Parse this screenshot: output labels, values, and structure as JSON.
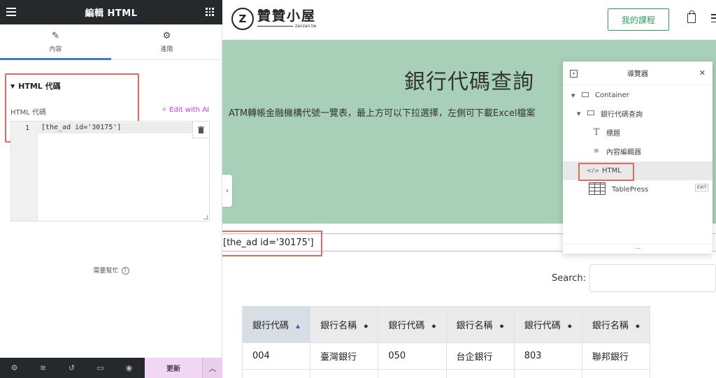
{
  "panel": {
    "title": "編輯 HTML",
    "tabs": [
      {
        "label": "內容",
        "icon": "pencil-icon",
        "active": true
      },
      {
        "label": "進階",
        "icon": "gear-icon",
        "active": false
      }
    ],
    "section_title": "HTML 代碼",
    "field_label": "HTML 代碼",
    "edit_ai_label": "✧ Edit with AI",
    "code": {
      "line_number": "1",
      "line_text": "[the_ad id='30175']"
    },
    "help_text": "需要幫忙",
    "footer": {
      "icons": [
        "settings-icon",
        "layers-icon",
        "history-icon",
        "responsive-icon",
        "preview-eye-icon"
      ],
      "update_label": "更新"
    }
  },
  "site": {
    "logo_mark": "Z",
    "logo_text": "贊贊小屋",
    "logo_sub": "zanzan.tw",
    "course_button": "我的課程"
  },
  "hero": {
    "title": "銀行代碼查詢",
    "description": "ATM轉帳金融機構代號一覽表，最上方可以下拉選擇，左側可下載Excel檔案"
  },
  "html_widget_text": "[the_ad id='30175']",
  "table": {
    "search_label": "Search:",
    "headers": [
      "銀行代碼",
      "銀行名稱",
      "銀行代碼",
      "銀行名稱",
      "銀行代碼",
      "銀行名稱"
    ],
    "rows": [
      [
        "004",
        "臺灣銀行",
        "050",
        "台企銀行",
        "803",
        "聯邦銀行"
      ]
    ]
  },
  "navigator": {
    "title": "導覽器",
    "items": [
      {
        "label": "Container",
        "level": 0
      },
      {
        "label": "銀行代碼查詢",
        "level": 1
      },
      {
        "label": "標題",
        "level": 2
      },
      {
        "label": "內容編輯器",
        "level": 2
      },
      {
        "label": "HTML",
        "level": 2,
        "selected": true
      },
      {
        "label": "TablePress",
        "level": 2
      }
    ],
    "exit_label": "EXIT",
    "footer": "..."
  },
  "colors": {
    "accent": "#3a7ad6",
    "hero_bg": "#a8d0b8",
    "highlight_box": "#e4695e",
    "ai_purple": "#c13bd6",
    "update_bg": "#f2d6f5",
    "brand_green": "#2e9e63"
  }
}
